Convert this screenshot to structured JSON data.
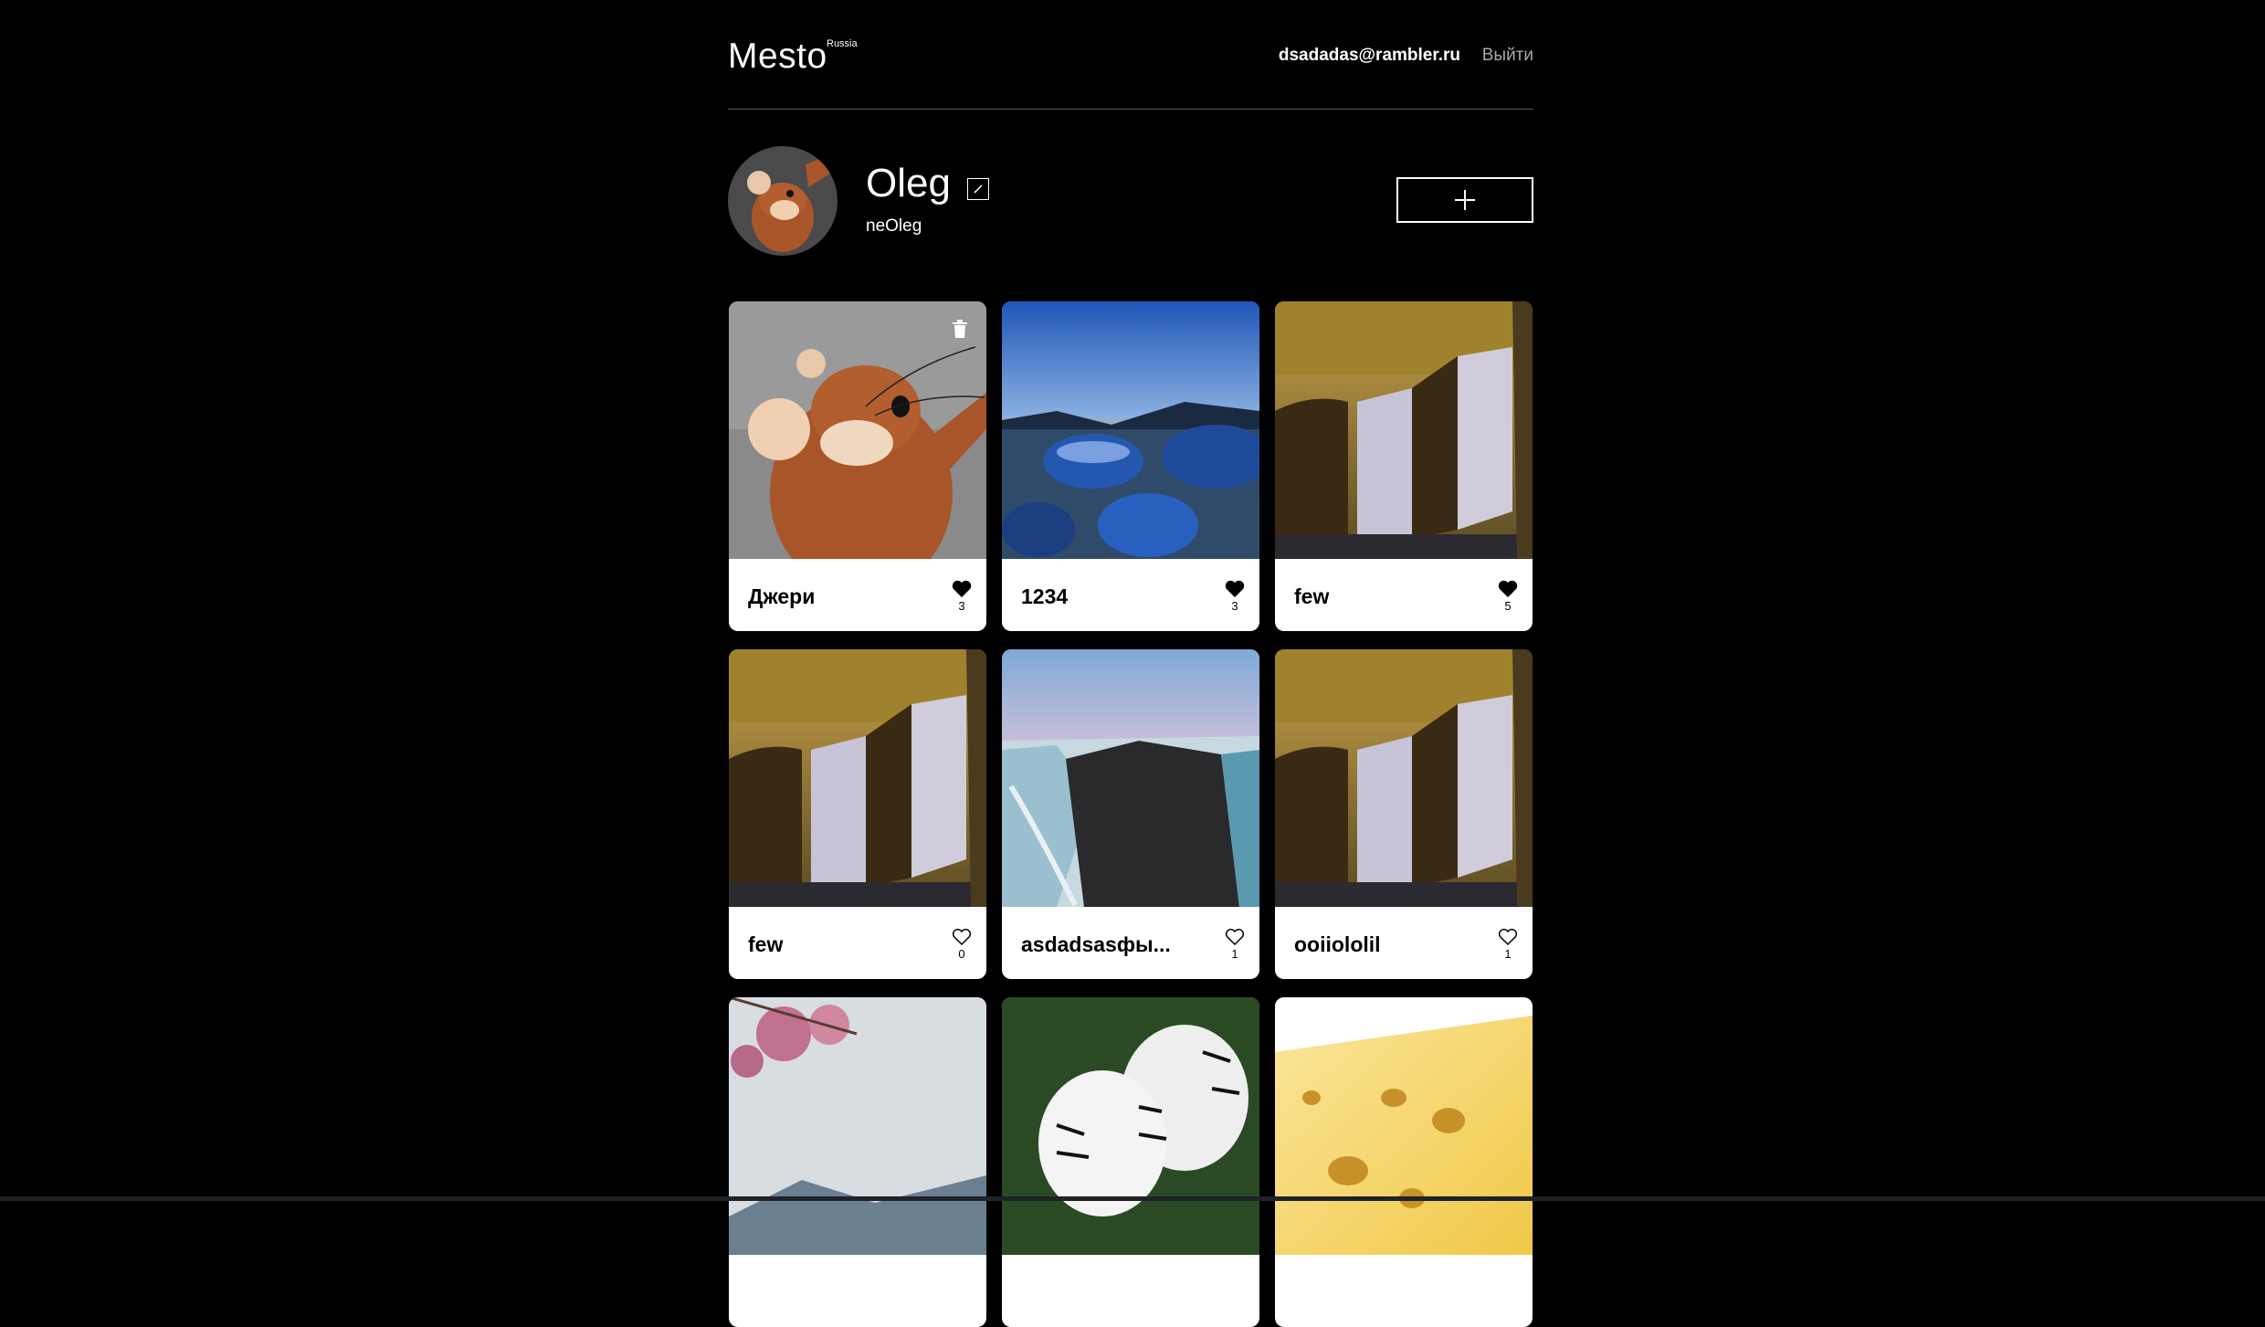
{
  "header": {
    "logo": "Mesto",
    "logo_sup": "Russia",
    "email": "dsadadas@rambler.ru",
    "logout": "Выйти"
  },
  "profile": {
    "name": "Oleg",
    "about": "neOleg"
  },
  "cards": [
    {
      "title": "Джери",
      "likes": "3",
      "liked": true,
      "own": true
    },
    {
      "title": "1234",
      "likes": "3",
      "liked": true,
      "own": false
    },
    {
      "title": "few",
      "likes": "5",
      "liked": true,
      "own": false
    },
    {
      "title": "few",
      "likes": "0",
      "liked": false,
      "own": false
    },
    {
      "title": "asdadsasфы...",
      "likes": "1",
      "liked": false,
      "own": false
    },
    {
      "title": "ooiiololil",
      "likes": "1",
      "liked": false,
      "own": false
    },
    {
      "title": "",
      "likes": "",
      "liked": false,
      "own": false
    },
    {
      "title": "",
      "likes": "",
      "liked": false,
      "own": false
    },
    {
      "title": "",
      "likes": "",
      "liked": false,
      "own": false
    }
  ]
}
